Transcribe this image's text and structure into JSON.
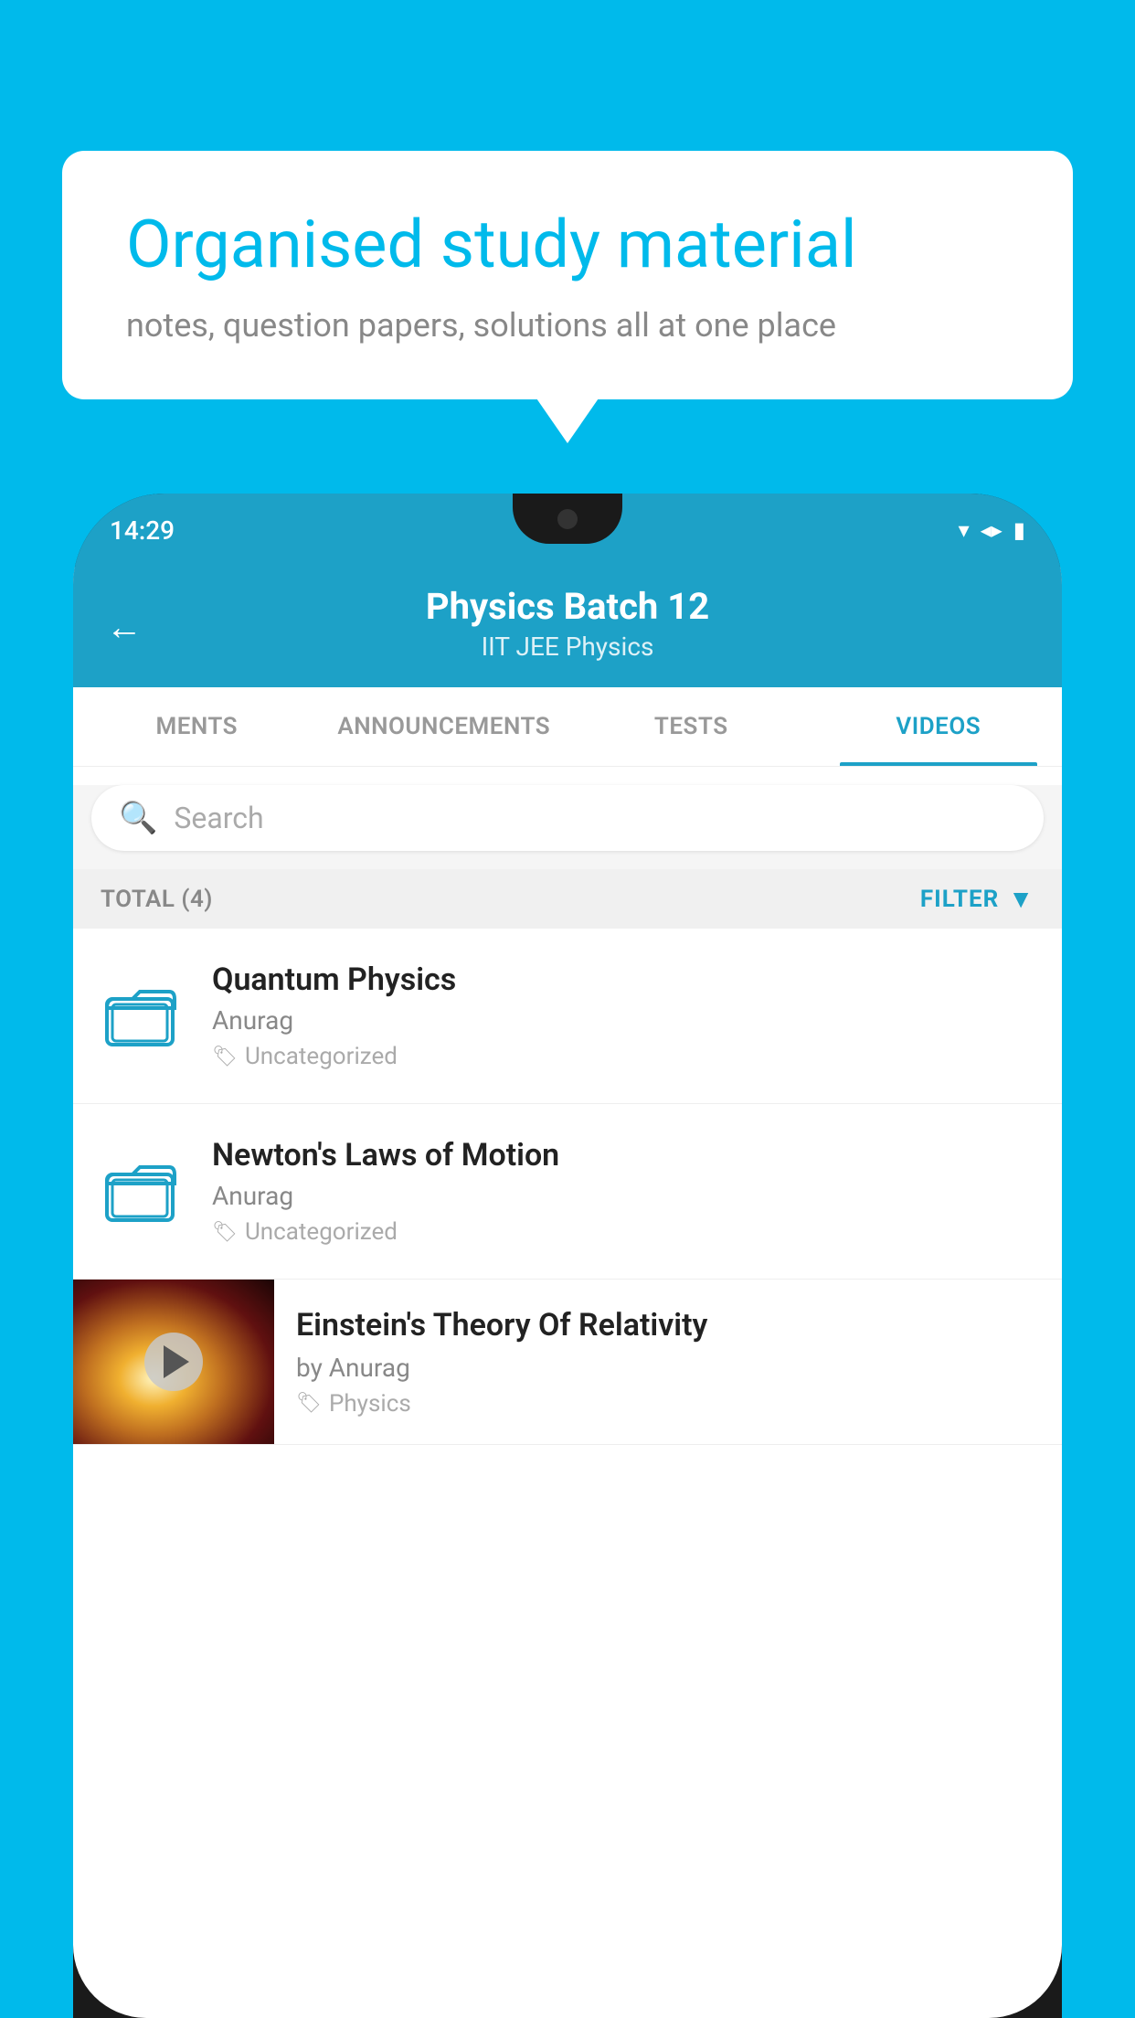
{
  "background_color": "#00BAEB",
  "bubble": {
    "title": "Organised study material",
    "subtitle": "notes, question papers, solutions all at one place"
  },
  "phone": {
    "status_bar": {
      "time": "14:29"
    },
    "header": {
      "title": "Physics Batch 12",
      "subtitle": "IIT JEE   Physics",
      "back_label": "←"
    },
    "tabs": [
      {
        "label": "MENTS",
        "active": false
      },
      {
        "label": "ANNOUNCEMENTS",
        "active": false
      },
      {
        "label": "TESTS",
        "active": false
      },
      {
        "label": "VIDEOS",
        "active": true
      }
    ],
    "search": {
      "placeholder": "Search"
    },
    "filter_bar": {
      "total_label": "TOTAL (4)",
      "filter_label": "FILTER"
    },
    "videos": [
      {
        "type": "folder",
        "title": "Quantum Physics",
        "author": "Anurag",
        "tag": "Uncategorized"
      },
      {
        "type": "folder",
        "title": "Newton's Laws of Motion",
        "author": "Anurag",
        "tag": "Uncategorized"
      },
      {
        "type": "thumbnail",
        "title": "Einstein's Theory Of Relativity",
        "author": "by Anurag",
        "tag": "Physics"
      }
    ]
  }
}
